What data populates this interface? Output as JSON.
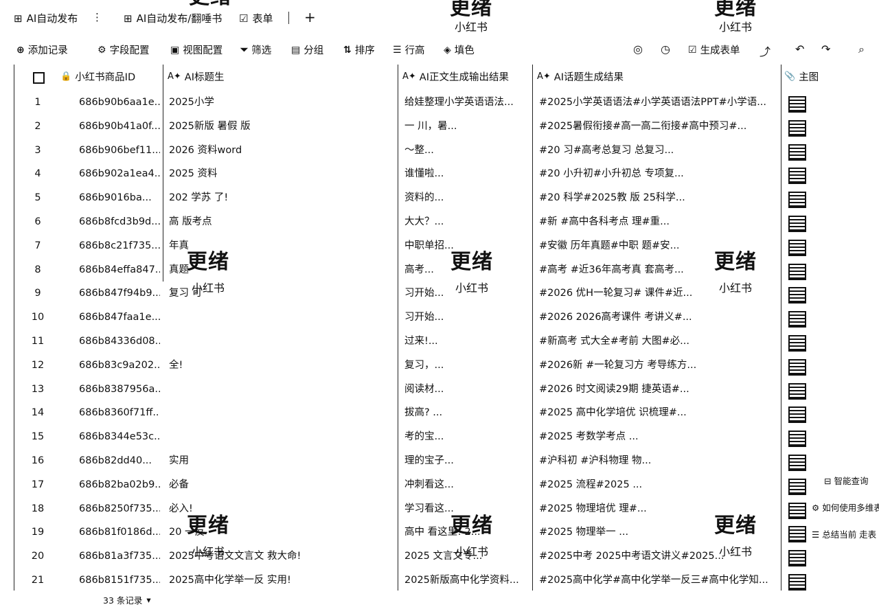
{
  "topbar": {
    "title": "AI自动发布",
    "more": "⋮",
    "table_tab": "AI自动发布/翻唾书",
    "form_tab": "表单",
    "add": "+",
    "wm_top": [
      "更绪",
      "更绪",
      "更绪"
    ],
    "wm_top_sub": [
      "小红书",
      "小红书"
    ]
  },
  "toolbar": {
    "add_record": "添加记录",
    "field_config": "字段配置",
    "view_config": "视图配置",
    "filter": "筛选",
    "group": "分组",
    "sort": "排序",
    "row_height": "行高",
    "fill_color": "填色",
    "generate_form": "生成表单"
  },
  "columns": {
    "id": "小红书商品ID",
    "title": "AI标题生",
    "body": "AI正文生成输出结果",
    "topic": "AI话题生成结果",
    "image": "主图"
  },
  "rows": [
    {
      "n": "1",
      "id": "686b90b6aa1e...",
      "title": "2025小学",
      "body": "给娃整理小学英语语法...",
      "topic": "#2025小学英语语法#小学英语语法PPT#小学语..."
    },
    {
      "n": "2",
      "id": "686b90b41a0f...",
      "title": "2025新版 暑假 版",
      "body": "一 川，暑...",
      "topic": "#2025暑假衔接#高一高二衔接#高中预习#..."
    },
    {
      "n": "3",
      "id": "686b906bef11...",
      "title": "2026 资料word",
      "body": "～整...",
      "topic": "#20 习#高考总复习 总复习..."
    },
    {
      "n": "4",
      "id": "686b902a1ea4...",
      "title": "2025 资料 ",
      "body": "谁懂啦...",
      "topic": "#20 小升初#小升初总 专项复..."
    },
    {
      "n": "5",
      "id": "686b9016ba...",
      "title": "202 学苏 了!",
      "body": "资料的...",
      "topic": "#20 科学#2025教 版 25科学..."
    },
    {
      "n": "6",
      "id": "686b8fcd3b9d...",
      "title": "高 版考点",
      "body": "大大？...",
      "topic": "#新 #高中各科考点 理#重..."
    },
    {
      "n": "7",
      "id": "686b8c21f735...",
      "title": "年真",
      "body": "中职单招...",
      "topic": "#安徽 历年真题#中职 题#安..."
    },
    {
      "n": "8",
      "id": "686b84effa847...",
      "title": "真题",
      "body": "高考...",
      "topic": "#高考 #近36年高考真 套高考..."
    },
    {
      "n": "9",
      "id": "686b847f94b9...",
      "title": "复习 可",
      "body": "习开始...",
      "topic": "#2026 优H一轮复习# 课件#近..."
    },
    {
      "n": "10",
      "id": "686b847faa1e...",
      "title": "",
      "body": "习开始...",
      "topic": "#2026 2026高考课件 考讲义#..."
    },
    {
      "n": "11",
      "id": "686b84336d08...",
      "title": "",
      "body": "过来!...",
      "topic": "#新高考 式大全#考前 大图#必..."
    },
    {
      "n": "12",
      "id": "686b83c9a202...",
      "title": "全!",
      "body": "复习，...",
      "topic": "#2026新 #一轮复习方 考导练方..."
    },
    {
      "n": "13",
      "id": "686b8387956a...",
      "title": "",
      "body": "阅读材...",
      "topic": "#2026 时文阅读29期 捷英语#..."
    },
    {
      "n": "14",
      "id": "686b8360f71ff...",
      "title": "",
      "body": "拔高? ...",
      "topic": "#2025 高中化学培优 识梳理#..."
    },
    {
      "n": "15",
      "id": "686b8344e53c...",
      "title": "",
      "body": "考的宝...",
      "topic": "#2025 考数学考点 ..."
    },
    {
      "n": "16",
      "id": "686b82dd40...",
      "title": "实用",
      "body": "理的宝子...",
      "topic": "#沪科初 #沪科物理 物..."
    },
    {
      "n": "17",
      "id": "686b82ba02b9...",
      "title": "必备",
      "body": "冲刺看这...",
      "topic": "#2025 流程#2025 ..."
    },
    {
      "n": "18",
      "id": "686b8250f735...",
      "title": "必入!",
      "body": "学习看这...",
      "topic": "#2025 物理培优 理#..."
    },
    {
      "n": "19",
      "id": "686b81f0186d...",
      "title": "20 一反",
      "body": "高中 看这里! 2...",
      "topic": "#2025 物理举一 ..."
    },
    {
      "n": "20",
      "id": "686b81a3f735...",
      "title": "2025中考语文文言文 救大命!",
      "body": "2025 文言文专...",
      "topic": "#2025中考 2025中考语文讲义#2025..."
    },
    {
      "n": "21",
      "id": "686b8151f735...",
      "title": "2025高中化学举一反 实用!",
      "body": "2025新版高中化学资料...",
      "topic": "#2025高中化学#高中化学举一反三#高中化学知..."
    }
  ],
  "watermark": {
    "big": "更绪",
    "small": "小红书"
  },
  "side_menu": [
    "智能查询",
    "如何使用多维表",
    "总结当前 走表"
  ],
  "footer": {
    "count": "33 条记录"
  }
}
